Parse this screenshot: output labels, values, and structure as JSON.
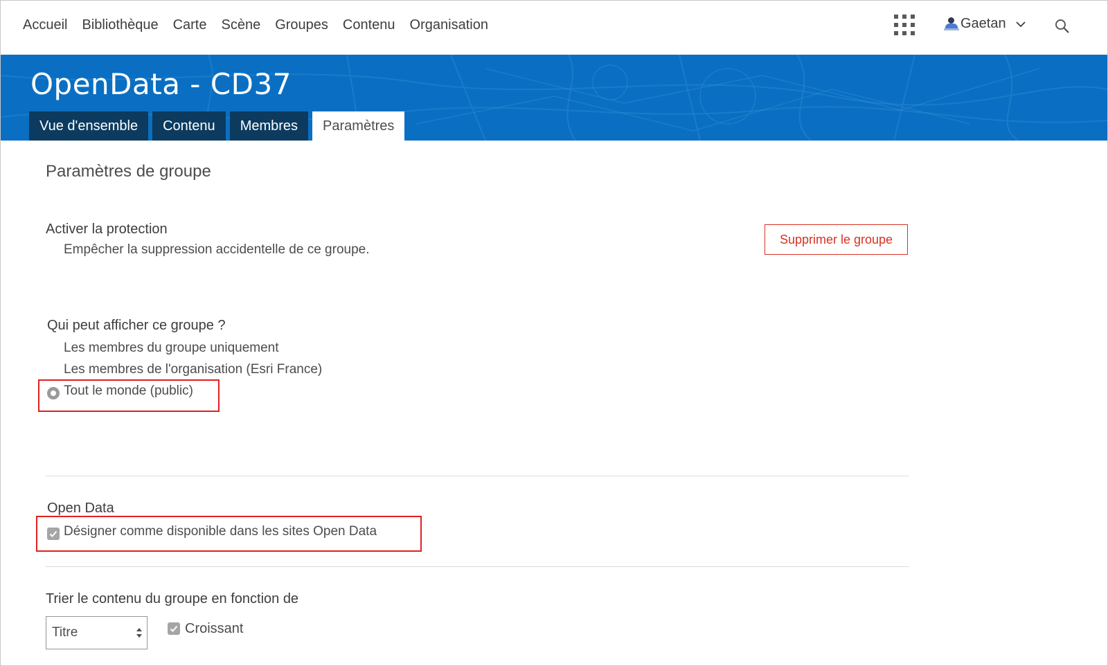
{
  "nav": {
    "links": [
      "Accueil",
      "Bibliothèque",
      "Carte",
      "Scène",
      "Groupes",
      "Contenu",
      "Organisation"
    ],
    "user_name": "Gaetan",
    "icons": [
      "apps-grid-icon",
      "user-avatar-icon",
      "chevron-down-icon",
      "search-icon"
    ]
  },
  "banner": {
    "title": "OpenData - CD37",
    "tabs": [
      "Vue d'ensemble",
      "Contenu",
      "Membres",
      "Paramètres"
    ],
    "active_tab": "Paramètres"
  },
  "settings": {
    "section_title": "Paramètres de groupe",
    "protection_label": "Activer la protection",
    "protection_desc": "Empêcher la suppression accidentelle de ce groupe.",
    "delete_button": "Supprimer le groupe",
    "who_label": "Qui peut afficher ce groupe ?",
    "visibility_options": [
      "Les membres du groupe uniquement",
      "Les membres de l'organisation (Esri France)",
      "Tout le monde (public)"
    ],
    "visibility_selected": "Tout le monde (public)",
    "open_data_label": "Open Data",
    "open_data_checkbox": "Désigner comme disponible dans les sites Open Data",
    "open_data_checked": true,
    "sort_label": "Trier le contenu du groupe en fonction de",
    "sort_field": "Titre",
    "ascending_label": "Croissant",
    "ascending_checked": true
  },
  "colors": {
    "banner": "#0a6fc2",
    "tab": "#0c3b5f",
    "danger": "#d83020",
    "highlight": "#e02020"
  }
}
